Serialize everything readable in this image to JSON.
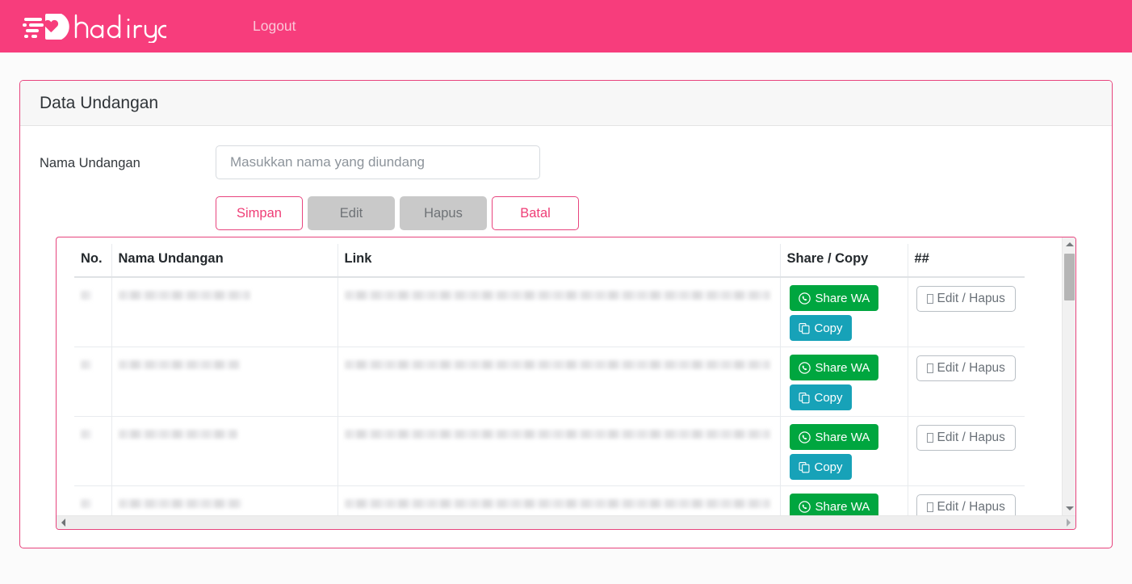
{
  "navbar": {
    "brand_text": "hadiryaa",
    "brand_icon": "heart-speed-logo-icon",
    "logout_label": "Logout",
    "background_color": "#f73d7c",
    "link_color": "#fbc7d8"
  },
  "card": {
    "title": "Data Undangan",
    "border_color": "#e7447d",
    "header_background": "#f7f7f7"
  },
  "form": {
    "name_label": "Nama Undangan",
    "name_value": "",
    "name_placeholder": "Masukkan nama yang diundang",
    "buttons": [
      {
        "label": "Simpan",
        "style": "outline-pink",
        "disabled": false
      },
      {
        "label": "Edit",
        "style": "disabled-gray",
        "disabled": true
      },
      {
        "label": "Hapus",
        "style": "disabled-gray",
        "disabled": true
      },
      {
        "label": "Batal",
        "style": "outline-pink",
        "disabled": false
      }
    ]
  },
  "table": {
    "columns": [
      "No.",
      "Nama Undangan",
      "Link",
      "Share / Copy",
      "##"
    ],
    "share_wa_label": "Share WA",
    "share_wa_icon": "whatsapp-icon",
    "share_wa_color": "#00a63f",
    "copy_label": "Copy",
    "copy_icon": "copy-icon",
    "copy_color": "#17a2b8",
    "edit_hapus_label": "Edit / Hapus",
    "edit_hapus_icon": "missing-glyph-tofu-icon",
    "rows": [
      {
        "no": "",
        "nama": "",
        "link": "",
        "redacted": true
      },
      {
        "no": "",
        "nama": "",
        "link": "",
        "redacted": true
      },
      {
        "no": "",
        "nama": "",
        "link": "",
        "redacted": true
      },
      {
        "no": "",
        "nama": "",
        "link": "",
        "redacted": true
      }
    ],
    "row_data_state": "redacted"
  },
  "scrollbars": {
    "vertical_position": "near-top",
    "horizontal_position": "left"
  }
}
